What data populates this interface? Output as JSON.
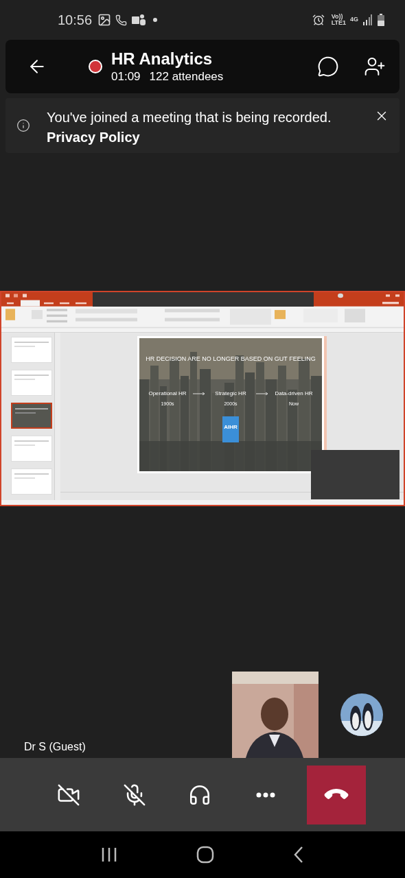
{
  "status_bar": {
    "time": "10:56",
    "volte": [
      "Vo))",
      "LTE1"
    ],
    "network": "4G"
  },
  "header": {
    "title": "HR Analytics",
    "recording": true,
    "elapsed": "01:09",
    "attendees": "122 attendees"
  },
  "banner": {
    "message": "You've joined a meeting that is being recorded.",
    "link": "Privacy Policy"
  },
  "shared_screen": {
    "thumbnails": [
      {
        "selected": false
      },
      {
        "selected": false
      },
      {
        "selected": true
      },
      {
        "selected": false
      },
      {
        "selected": false
      }
    ],
    "slide": {
      "title": "HR DECISION ARE NO LONGER BASED ON GUT FEELING",
      "stages": [
        {
          "label": "Operational HR",
          "period": "1900s"
        },
        {
          "label": "Strategic HR",
          "period": "2000s"
        },
        {
          "label": "Data-driven HR",
          "period": "Now"
        }
      ],
      "logo": "AIHR"
    }
  },
  "participant": {
    "name": "Dr S (Guest)"
  },
  "controls": [
    {
      "kind": "camera",
      "off": true
    },
    {
      "kind": "mic",
      "off": true
    },
    {
      "kind": "audio"
    },
    {
      "kind": "more"
    },
    {
      "kind": "hangup"
    }
  ]
}
